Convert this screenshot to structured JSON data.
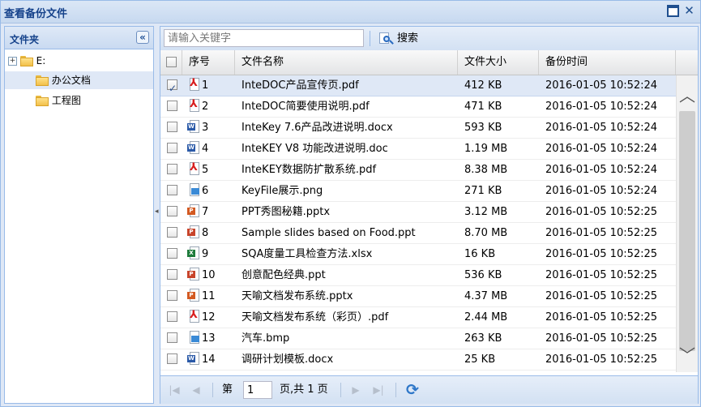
{
  "window": {
    "title": "查看备份文件"
  },
  "sidebar": {
    "title": "文件夹",
    "tree": [
      {
        "label": "E:",
        "level": 0,
        "expandable": true
      },
      {
        "label": "办公文档",
        "level": 1,
        "selected": true
      },
      {
        "label": "工程图",
        "level": 1
      }
    ]
  },
  "toolbar": {
    "search_placeholder": "请输入关键字",
    "search_label": "搜索"
  },
  "grid": {
    "columns": [
      "序号",
      "文件名称",
      "文件大小",
      "备份时间"
    ],
    "rows": [
      {
        "idx": "1",
        "name": "InteDOC产品宣传页.pdf",
        "size": "412 KB",
        "time": "2016-01-05 10:52:24",
        "icon": "pdf",
        "checked": true
      },
      {
        "idx": "2",
        "name": "InteDOC简要使用说明.pdf",
        "size": "471 KB",
        "time": "2016-01-05 10:52:24",
        "icon": "pdf"
      },
      {
        "idx": "3",
        "name": "InteKey 7.6产品改进说明.docx",
        "size": "593 KB",
        "time": "2016-01-05 10:52:24",
        "icon": "doc"
      },
      {
        "idx": "4",
        "name": "InteKEY V8 功能改进说明.doc",
        "size": "1.19 MB",
        "time": "2016-01-05 10:52:24",
        "icon": "doc"
      },
      {
        "idx": "5",
        "name": "InteKEY数据防扩散系统.pdf",
        "size": "8.38 MB",
        "time": "2016-01-05 10:52:24",
        "icon": "pdf"
      },
      {
        "idx": "6",
        "name": "KeyFile展示.png",
        "size": "271 KB",
        "time": "2016-01-05 10:52:24",
        "icon": "img"
      },
      {
        "idx": "7",
        "name": "PPT秀图秘籍.pptx",
        "size": "3.12 MB",
        "time": "2016-01-05 10:52:25",
        "icon": "ppt"
      },
      {
        "idx": "8",
        "name": "Sample slides based on Food.ppt",
        "size": "8.70 MB",
        "time": "2016-01-05 10:52:25",
        "icon": "pptold"
      },
      {
        "idx": "9",
        "name": "SQA度量工具检查方法.xlsx",
        "size": "16 KB",
        "time": "2016-01-05 10:52:25",
        "icon": "xls"
      },
      {
        "idx": "10",
        "name": "创意配色经典.ppt",
        "size": "536 KB",
        "time": "2016-01-05 10:52:25",
        "icon": "pptold"
      },
      {
        "idx": "11",
        "name": "天喻文档发布系统.pptx",
        "size": "4.37 MB",
        "time": "2016-01-05 10:52:25",
        "icon": "ppt"
      },
      {
        "idx": "12",
        "name": "天喻文档发布系统（彩页）.pdf",
        "size": "2.44 MB",
        "time": "2016-01-05 10:52:25",
        "icon": "pdf"
      },
      {
        "idx": "13",
        "name": "汽车.bmp",
        "size": "263 KB",
        "time": "2016-01-05 10:52:25",
        "icon": "img"
      },
      {
        "idx": "14",
        "name": "调研计划模板.docx",
        "size": "25 KB",
        "time": "2016-01-05 10:52:25",
        "icon": "doc"
      }
    ]
  },
  "pager": {
    "page_prefix": "第",
    "current_page": "1",
    "page_suffix": "页,共 1 页"
  },
  "icons": {
    "pdf": "pdf-icon",
    "doc": "word-doc-icon",
    "ppt": "powerpoint-icon",
    "pptold": "powerpoint-legacy-icon",
    "xls": "excel-icon",
    "img": "image-icon"
  }
}
